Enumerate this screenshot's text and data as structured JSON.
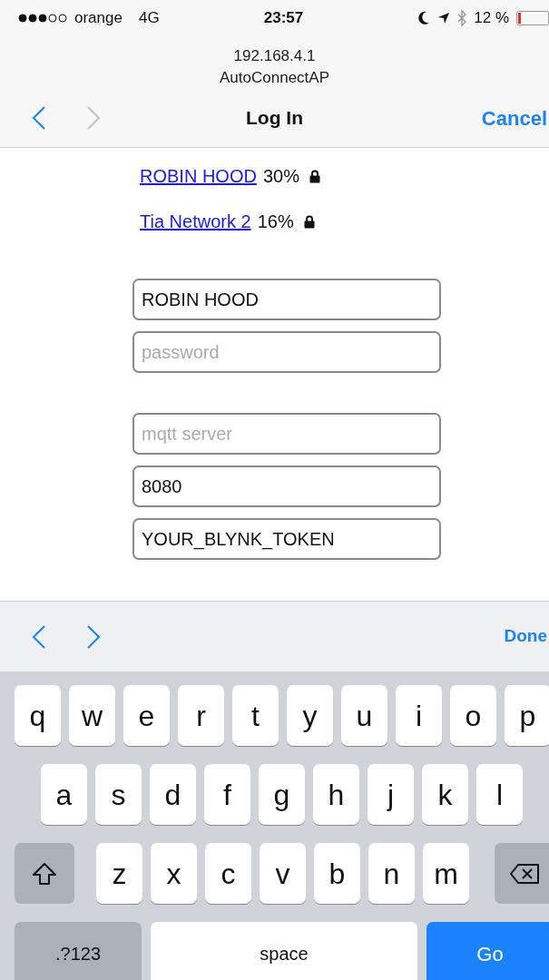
{
  "status_bar": {
    "carrier": "orange",
    "network": "4G",
    "time": "23:57",
    "battery": "12 %"
  },
  "address": {
    "host": "192.168.4.1",
    "page_title": "AutoConnectAP"
  },
  "nav": {
    "back": {
      "disabled": false
    },
    "forward": {
      "disabled": true
    },
    "title": "Log In",
    "action": "Cancel"
  },
  "networks": [
    {
      "name": "ROBIN HOOD",
      "signal": "30%",
      "locked": true
    },
    {
      "name": "Tia Network 2",
      "signal": "16%",
      "locked": true
    }
  ],
  "field_groups": [
    [
      {
        "value": "ROBIN HOOD"
      },
      {
        "placeholder": "password"
      }
    ],
    [
      {
        "placeholder": "mqtt server"
      },
      {
        "value": "8080"
      },
      {
        "value": "YOUR_BLYNK_TOKEN"
      }
    ]
  ],
  "accessory_bar": {
    "previous": {
      "disabled": false
    },
    "next": {
      "disabled": false
    },
    "done": "Done"
  },
  "keyboard": {
    "rows": [
      [
        "q",
        "w",
        "e",
        "r",
        "t",
        "y",
        "u",
        "i",
        "o",
        "p"
      ],
      [
        "a",
        "s",
        "d",
        "f",
        "g",
        "h",
        "j",
        "k",
        "l"
      ],
      [
        "z",
        "x",
        "c",
        "v",
        "b",
        "n",
        "m"
      ]
    ],
    "bottom": [
      {
        "kind": "mode",
        "label": ".?123"
      },
      {
        "kind": "space",
        "label": "space"
      },
      {
        "kind": "action",
        "label": "Go"
      }
    ]
  }
}
